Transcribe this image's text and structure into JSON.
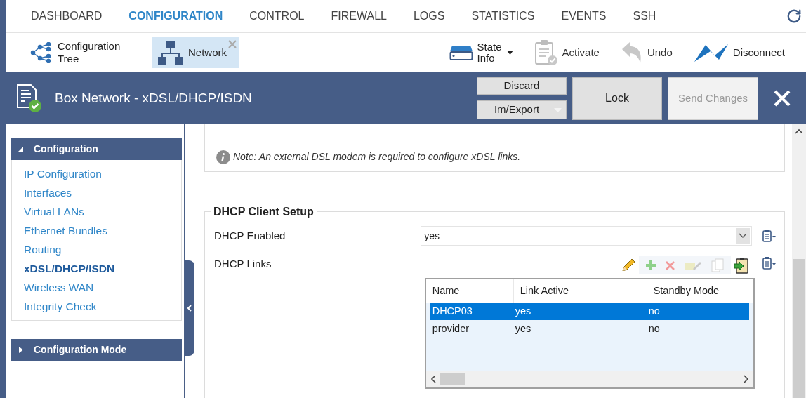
{
  "nav": {
    "tabs": [
      {
        "label": "DASHBOARD",
        "selected": false
      },
      {
        "label": "CONFIGURATION",
        "selected": true
      },
      {
        "label": "CONTROL",
        "selected": false
      },
      {
        "label": "FIREWALL",
        "selected": false
      },
      {
        "label": "LOGS",
        "selected": false
      },
      {
        "label": "STATISTICS",
        "selected": false
      },
      {
        "label": "EVENTS",
        "selected": false
      },
      {
        "label": "SSH",
        "selected": false
      }
    ]
  },
  "toolbar": {
    "tabs": [
      {
        "kind": "tree",
        "label": "Configuration Tree",
        "selected": false,
        "closable": false
      },
      {
        "kind": "network",
        "label": "Network",
        "selected": true,
        "closable": true
      }
    ],
    "actions": [
      {
        "kind": "state",
        "label": "State Info",
        "dropdown": true,
        "disabled": false
      },
      {
        "kind": "activate",
        "label": "Activate",
        "dropdown": false,
        "disabled": true
      },
      {
        "kind": "undo",
        "label": "Undo",
        "dropdown": false,
        "disabled": true
      },
      {
        "kind": "disconnect",
        "label": "Disconnect",
        "dropdown": false,
        "disabled": false
      }
    ]
  },
  "header": {
    "title": "Box Network - xDSL/DHCP/ISDN",
    "discard": "Discard",
    "im_export": "Im/Export",
    "lock": "Lock",
    "send_changes": {
      "label": "Send Changes",
      "disabled": true
    }
  },
  "sidebar": {
    "sections": [
      {
        "title": "Configuration",
        "expanded": true,
        "items": [
          {
            "label": "IP Configuration",
            "selected": false
          },
          {
            "label": "Interfaces",
            "selected": false
          },
          {
            "label": "Virtual LANs",
            "selected": false
          },
          {
            "label": "Ethernet Bundles",
            "selected": false
          },
          {
            "label": "Routing",
            "selected": false
          },
          {
            "label": "xDSL/DHCP/ISDN",
            "selected": true
          },
          {
            "label": "Wireless WAN",
            "selected": false
          },
          {
            "label": "Integrity Check",
            "selected": false
          }
        ]
      },
      {
        "title": "Configuration Mode",
        "expanded": false
      }
    ]
  },
  "content": {
    "note": "Note: An external DSL modem is required to configure xDSL links.",
    "group_title": "DHCP Client Setup",
    "dhcp_enabled": {
      "label": "DHCP Enabled",
      "value": "yes"
    },
    "dhcp_links": {
      "label": "DHCP Links",
      "columns": [
        "Name",
        "Link Active",
        "Standby Mode"
      ],
      "rows": [
        {
          "cells": [
            "DHCP03",
            "yes",
            "no"
          ],
          "selected": true
        },
        {
          "cells": [
            "provider",
            "yes",
            "no"
          ],
          "selected": false
        }
      ]
    }
  }
}
